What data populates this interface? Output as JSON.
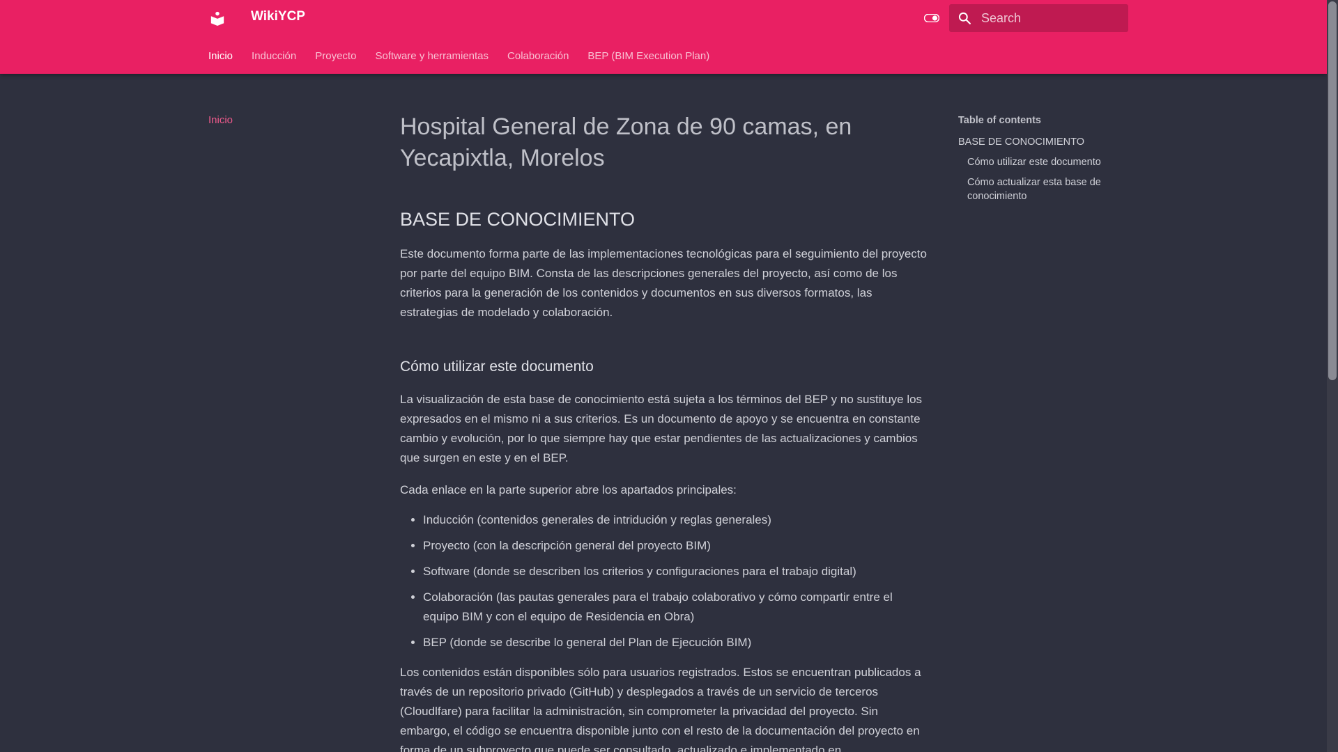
{
  "header": {
    "site_title": "WikiYCP",
    "search_placeholder": "Search",
    "brand_color": "#e92063"
  },
  "tabs": [
    {
      "label": "Inicio",
      "active": true
    },
    {
      "label": "Inducción",
      "active": false
    },
    {
      "label": "Proyecto",
      "active": false
    },
    {
      "label": "Software y herramientas",
      "active": false
    },
    {
      "label": "Colaboración",
      "active": false
    },
    {
      "label": "BEP (BIM Execution Plan)",
      "active": false
    }
  ],
  "leftnav": {
    "items": [
      {
        "label": "Inicio"
      }
    ]
  },
  "content": {
    "title": "Hospital General de Zona de 90 camas, en Yecapixtla, Morelos",
    "section1": {
      "heading": "BASE DE CONOCIMIENTO",
      "p1": "Este documento forma parte de las implementaciones tecnológicas para el seguimiento del proyecto por parte del equipo BIM. Consta de las descripciones generales del proyecto, así como de los criterios para la generación de los contenidos y documentos en sus diversos formatos, las estrategias de modelado y colaboración."
    },
    "section2": {
      "heading": "Cómo utilizar este documento",
      "p1": "La visualización de esta base de conocimiento está sujeta a los términos del BEP y no sustituye los expresados en el mismo ni a sus criterios. Es un documento de apoyo y se encuentra en constante cambio y evolución, por lo que siempre hay que estar pendientes de las actualizaciones y cambios que surgen en este y en el BEP.",
      "p2": "Cada enlace en la parte superior abre los apartados principales:",
      "list": [
        "Inducción (contenidos generales de intridución y reglas generales)",
        "Proyecto (con la descripción general del proyecto BIM)",
        "Software (donde se describen los criterios y configuraciones para el trabajo digital)",
        "Colaboración (las pautas generales para el trabajo colaborativo y cómo compartir entre el equipo BIM y con el equipo de Residencia en Obra)",
        "BEP (donde se describe lo general del Plan de Ejecución BIM)"
      ],
      "p3": "Los contenidos están disponibles sólo para usuarios registrados. Estos se encuentran publicados a través de un repositorio privado (GitHub) y desplegados a través de un servicio de terceros (Cloudlfare) para facilitar la administración, sin comprometer la privacidad del proyecto. Sin embargo, el código se encuentra disponible junto con el resto de la documentación del proyecto en forma de un subproyecto que puede ser consultado, actualizado e implementado en"
    }
  },
  "toc": {
    "title": "Table of contents",
    "items": [
      {
        "label": "BASE DE CONOCIMIENTO",
        "level": 1
      },
      {
        "label": "Cómo utilizar este documento",
        "level": 2
      },
      {
        "label": "Cómo actualizar esta base de conocimiento",
        "level": 2
      }
    ]
  },
  "icons": {
    "logo": "book-icon",
    "theme_toggle": "toggle-icon",
    "search": "search-icon"
  }
}
